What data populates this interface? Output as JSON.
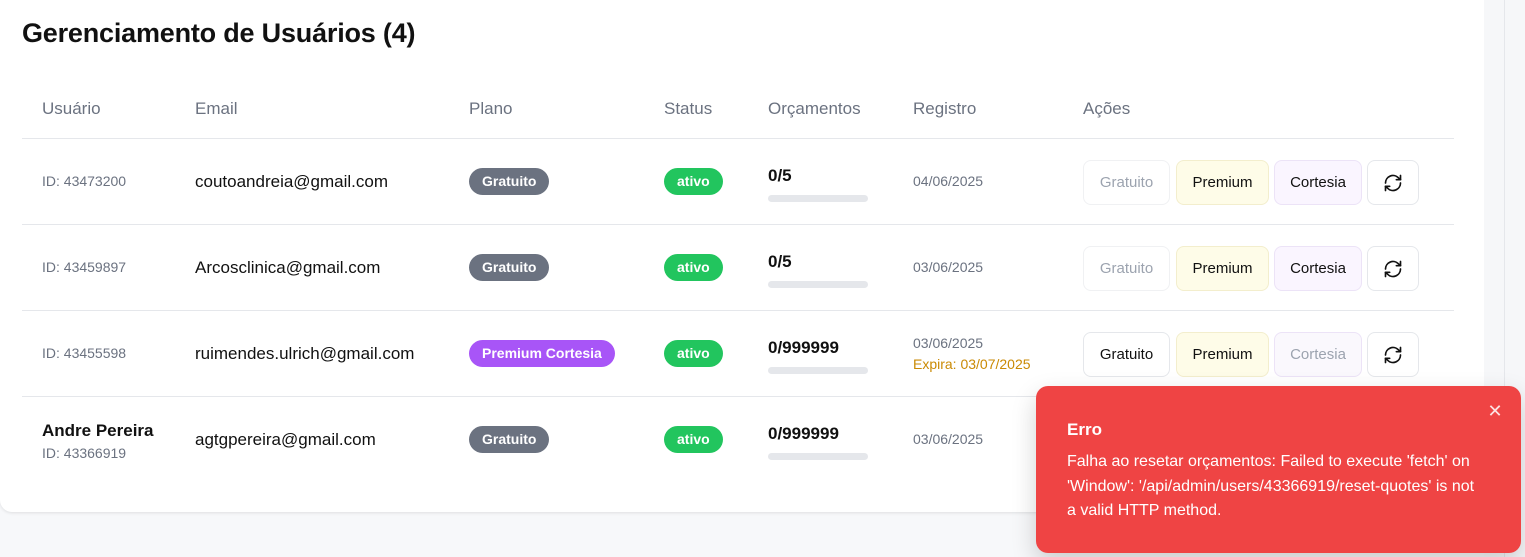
{
  "page": {
    "title": "Gerenciamento de Usuários (4)"
  },
  "table": {
    "headers": {
      "user": "Usuário",
      "email": "Email",
      "plan": "Plano",
      "status": "Status",
      "quotes": "Orçamentos",
      "registered": "Registro",
      "actions": "Ações"
    },
    "rows": [
      {
        "name": "",
        "id": "ID: 43473200",
        "email": "coutoandreia@gmail.com",
        "plan": "Gratuito",
        "status": "ativo",
        "quotes": "0/5",
        "quota_used_fraction": 0,
        "registered": "04/06/2025",
        "expires": ""
      },
      {
        "name": "",
        "id": "ID: 43459897",
        "email": "Arcosclinica@gmail.com",
        "plan": "Gratuito",
        "status": "ativo",
        "quotes": "0/5",
        "quota_used_fraction": 0,
        "registered": "03/06/2025",
        "expires": ""
      },
      {
        "name": "",
        "id": "ID: 43455598",
        "email": "ruimendes.ulrich@gmail.com",
        "plan": "Premium Cortesia",
        "status": "ativo",
        "quotes": "0/999999",
        "quota_used_fraction": 0,
        "registered": "03/06/2025",
        "expires": "Expira: 03/07/2025"
      },
      {
        "name": "Andre Pereira",
        "id": "ID: 43366919",
        "email": "agtgpereira@gmail.com",
        "plan": "Gratuito",
        "status": "ativo",
        "quotes": "0/999999",
        "quota_used_fraction": 0,
        "registered": "03/06/2025",
        "expires": ""
      }
    ],
    "actions": {
      "free_label": "Gratuito",
      "premium_label": "Premium",
      "courtesy_label": "Cortesia",
      "reset_icon": "refresh-icon"
    }
  },
  "toast": {
    "title": "Erro",
    "message": "Falha ao resetar orçamentos: Failed to execute 'fetch' on 'Window': '/api/admin/users/43366919/reset-quotes' is not a valid HTTP method.",
    "close_icon": "close-icon"
  },
  "colors": {
    "free_badge": "#6b7280",
    "courtesy_badge": "#a855f7",
    "active_badge": "#22c55e",
    "toast_error": "#ef4444",
    "expires_text": "#ca8a04"
  }
}
